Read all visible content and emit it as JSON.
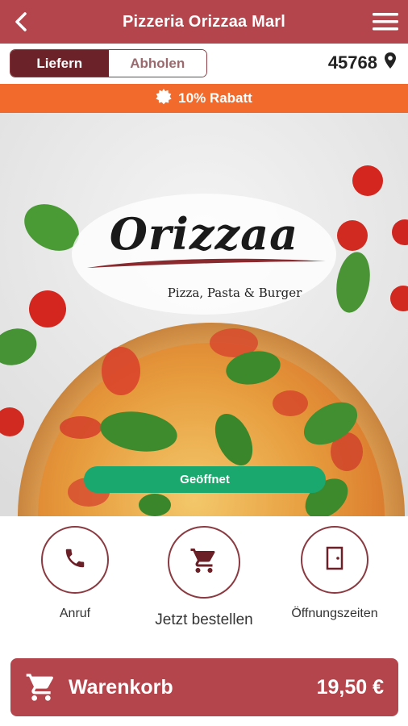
{
  "header": {
    "title": "Pizzeria Orizzaa Marl",
    "back_icon": "back-arrow-icon",
    "menu_icon": "hamburger-menu-icon"
  },
  "mode": {
    "options": [
      "Liefern",
      "Abholen"
    ],
    "selected": "Liefern"
  },
  "location": {
    "postal_code": "45768",
    "icon": "map-pin-icon"
  },
  "promo": {
    "text": "10% Rabatt",
    "icon": "badge-icon"
  },
  "logo": {
    "name": "Orizzaa",
    "tagline": "Pizza, Pasta & Burger"
  },
  "status": {
    "label": "Geöffnet"
  },
  "actions": [
    {
      "label": "Anruf",
      "icon": "phone-icon"
    },
    {
      "label": "Jetzt bestellen",
      "icon": "cart-icon"
    },
    {
      "label": "Öffnungszeiten",
      "icon": "door-icon"
    }
  ],
  "cart": {
    "label": "Warenkorb",
    "total": "19,50 €",
    "icon": "cart-icon"
  },
  "colors": {
    "brand": "#b5454c",
    "dark_brand": "#6b2228",
    "promo": "#f26a2c",
    "status_open": "#1aa86e"
  }
}
